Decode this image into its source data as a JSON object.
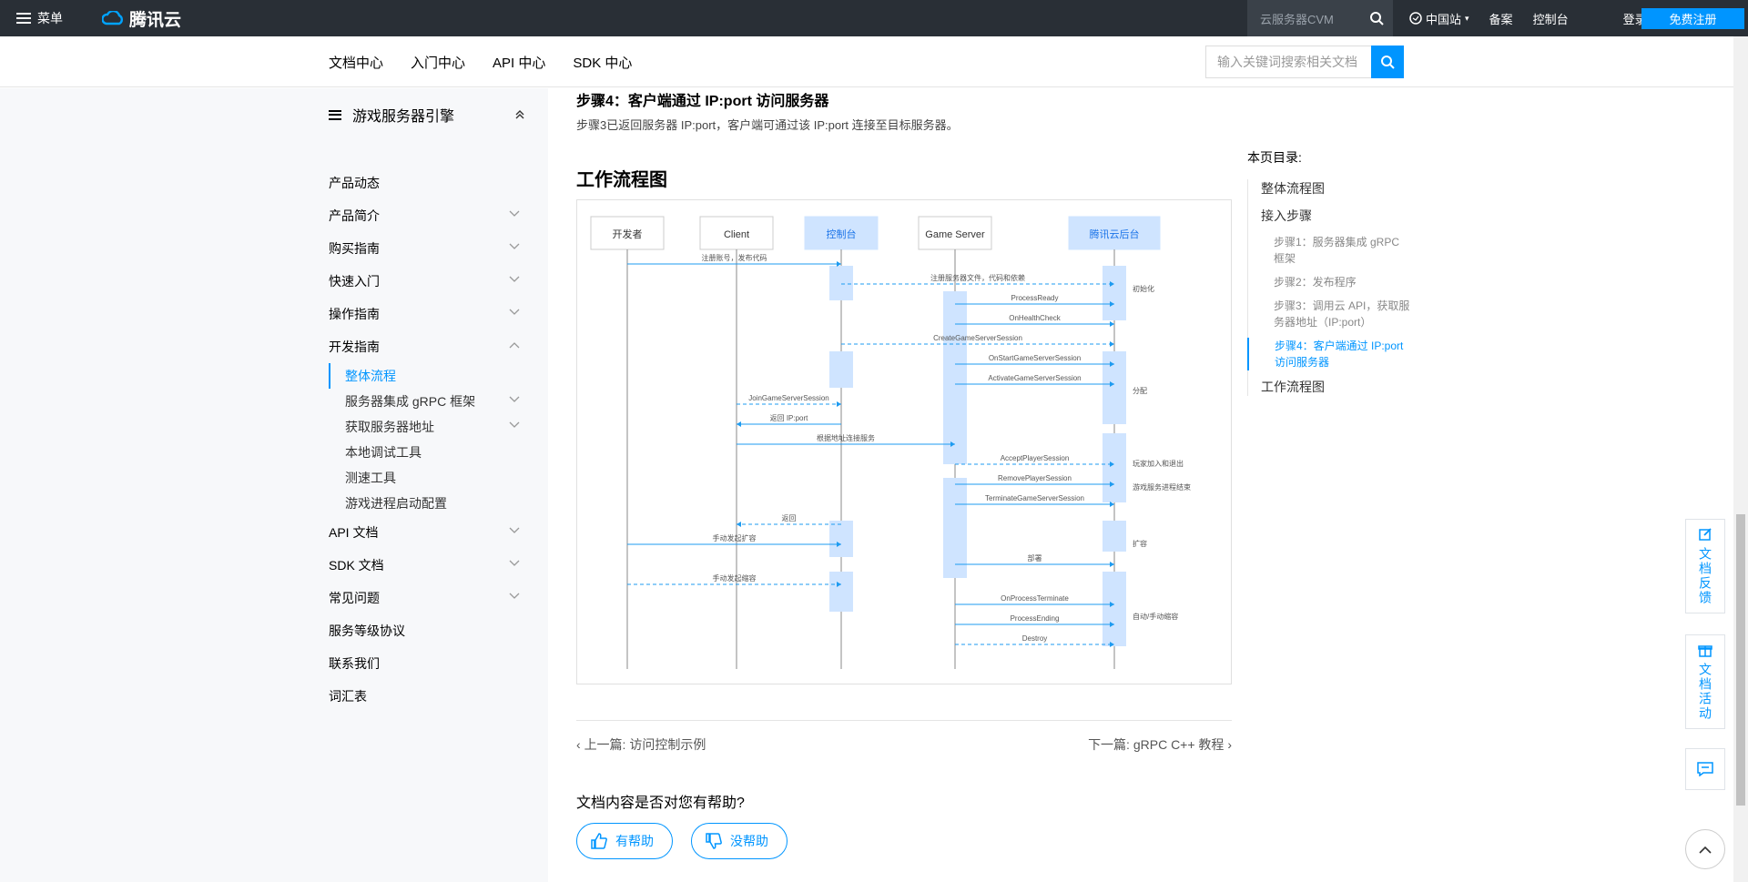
{
  "topbar": {
    "menu_label": "菜单",
    "brand": "腾讯云",
    "search_placeholder": "云服务器CVM",
    "site_label": "中国站",
    "links": [
      "备案",
      "控制台",
      "登录"
    ],
    "signup_label": "免费注册"
  },
  "subnav": {
    "items": [
      "文档中心",
      "入门中心",
      "API 中心",
      "SDK 中心"
    ],
    "search_placeholder": "输入关键词搜索相关文档"
  },
  "sidebar": {
    "title": "游戏服务器引擎",
    "items": [
      {
        "label": "产品动态"
      },
      {
        "label": "产品简介"
      },
      {
        "label": "购买指南"
      },
      {
        "label": "快速入门"
      },
      {
        "label": "操作指南"
      },
      {
        "label": "开发指南"
      }
    ],
    "dev_children": [
      {
        "label": "整体流程"
      },
      {
        "label": "服务器集成 gRPC 框架"
      },
      {
        "label": "获取服务器地址"
      },
      {
        "label": "本地调试工具"
      },
      {
        "label": "测速工具"
      },
      {
        "label": "游戏进程启动配置"
      }
    ],
    "items_after": [
      {
        "label": "API 文档"
      },
      {
        "label": "SDK 文档"
      },
      {
        "label": "常见问题"
      },
      {
        "label": "服务等级协议"
      },
      {
        "label": "联系我们"
      },
      {
        "label": "词汇表"
      }
    ]
  },
  "main": {
    "step_title": "步骤4：客户端通过 IP:port 访问服务器",
    "step_desc": "步骤3已返回服务器 IP:port，客户端可通过该 IP:port 连接至目标服务器。",
    "section_title": "工作流程图",
    "diagram": {
      "lanes": [
        "开发者",
        "Client",
        "控制台",
        "Game Server",
        "腾讯云后台"
      ],
      "messages": [
        "注册账号，发布代码",
        "注册服务器文件，代码和依赖",
        "ProcessReady",
        "OnHealthCheck",
        "CreateGameServerSession",
        "OnStartGameServerSession",
        "ActivateGameServerSession",
        "JoinGameServerSession",
        "返回 IP:port",
        "根据地址连接服务",
        "AcceptPlayerSession",
        "RemovePlayerSession",
        "TerminateGameServerSession",
        "返回",
        "手动发起扩容",
        "部署",
        "手动发起缩容",
        "OnProcessTerminate",
        "ProcessEnding",
        "Destroy"
      ],
      "notes": [
        "初始化",
        "分配",
        "玩家加入和退出",
        "游戏服务进程结束",
        "扩容",
        "自动/手动缩容"
      ]
    },
    "prev": "上一篇: 访问控制示例",
    "next": "下一篇: gRPC C++ 教程",
    "help_question": "文档内容是否对您有帮助?",
    "helpful": "有帮助",
    "not_helpful": "没帮助"
  },
  "toc": {
    "title": "本页目录:",
    "items": [
      "整体流程图",
      "接入步骤"
    ],
    "steps": [
      "步骤1：服务器集成 gRPC 框架",
      "步骤2：发布程序",
      "步骤3：调用云 API，获取服务器地址（IP:port）",
      "步骤4：客户端通过 IP:port 访问服务器"
    ],
    "last": "工作流程图"
  },
  "float": {
    "feedback": "文档反馈",
    "activity": "文档活动"
  },
  "colors": {
    "accent": "#0095ff",
    "topbar": "#292f36",
    "sidebar_bg": "#f7f8fa"
  }
}
